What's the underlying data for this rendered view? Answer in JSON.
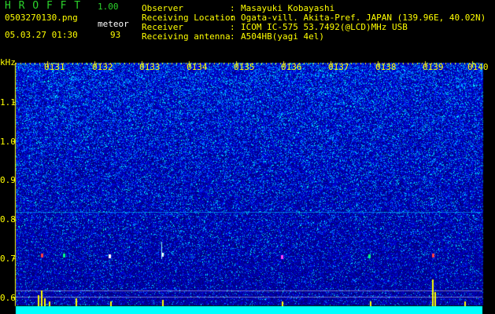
{
  "header": {
    "app_title": "H R O F F T",
    "version": "1.00",
    "filename": "0503270130.png",
    "datetime": "05.03.27 01:30",
    "mode_label": "meteor",
    "count": "93"
  },
  "info": {
    "rows": [
      {
        "label": "Observer",
        "sep": ":",
        "value": "Masayuki Kobayashi"
      },
      {
        "label": "Receiving Location",
        "sep": ":",
        "value": "Ogata-vill. Akita-Pref. JAPAN (139.96E, 40.02N)"
      },
      {
        "label": "Receiver",
        "sep": ":",
        "value": "ICOM IC-575 53.7492(@LCD)MHz USB"
      },
      {
        "label": "Receiving antenna",
        "sep": ":",
        "value": "A504HB(yagi 4el)"
      }
    ]
  },
  "spectrogram": {
    "unit": "kHz",
    "y_ticks": [
      "1.1",
      "1.0",
      "0.9",
      "0.8",
      "0.7",
      "0.6"
    ],
    "x_ticks": [
      "0131",
      "0132",
      "0133",
      "0134",
      "0135",
      "0136",
      "0137",
      "0138",
      "0139",
      "0140"
    ],
    "colors": {
      "axis": "#ffff00",
      "baseline": "#00ffff",
      "header_green": "#2bd32b"
    }
  }
}
